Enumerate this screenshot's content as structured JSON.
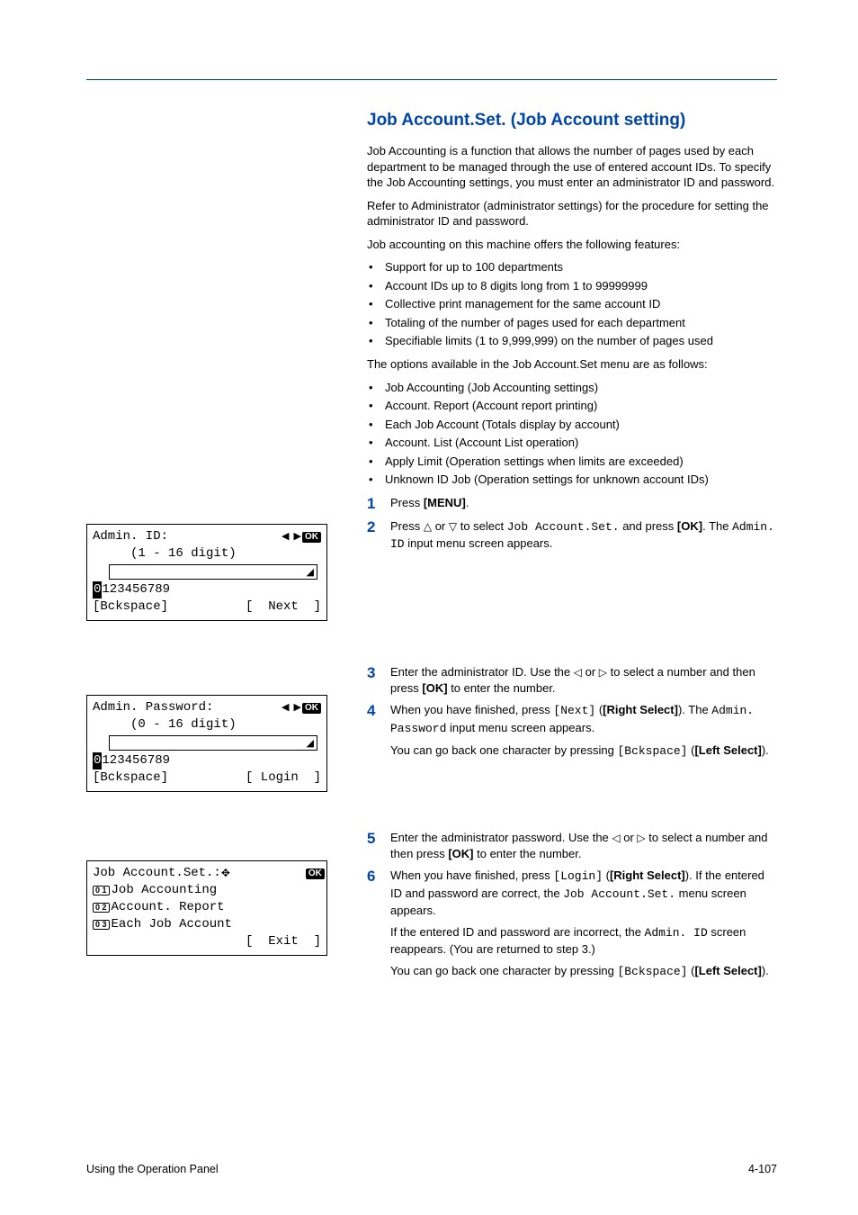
{
  "section_title": "Job Account.Set. (Job Account setting)",
  "intro_p1": "Job Accounting is a function that allows the number of pages used by each department to be managed through the use of entered account IDs. To specify the Job Accounting settings, you must enter an administrator ID and password.",
  "intro_p2": "Refer to Administrator (administrator settings) for the procedure for setting the administrator ID and password.",
  "intro_p3": "Job accounting on this machine offers the following features:",
  "features": [
    "Support for up to 100 departments",
    "Account IDs up to 8 digits long from 1 to 99999999",
    "Collective print management for the same account ID",
    "Totaling of the number of pages used for each department",
    "Specifiable limits (1 to 9,999,999) on the number of pages used"
  ],
  "options_lead": "The options available in the Job Account.Set menu are as follows:",
  "options": [
    "Job Accounting (Job Accounting settings)",
    "Account. Report (Account report printing)",
    "Each Job Account (Totals display by account)",
    "Account. List (Account List operation)",
    "Apply Limit (Operation settings when limits are exceeded)",
    "Unknown ID Job (Operation settings for unknown account IDs)"
  ],
  "steps": {
    "s1_a": "Press ",
    "s1_menu": "[MENU]",
    "s1_b": ".",
    "s2_a": "Press ",
    "s2_b": " or ",
    "s2_c": " to select ",
    "s2_code": "Job Account.Set.",
    "s2_d": " and press ",
    "s2_ok": "[OK]",
    "s2_e": ". The ",
    "s2_code2": "Admin. ID",
    "s2_f": " input menu screen appears.",
    "s3_a": "Enter the administrator ID. Use the ",
    "s3_b": " or ",
    "s3_c": " to select a number and then press ",
    "s3_ok": "[OK]",
    "s3_d": " to enter the number.",
    "s4_a": "When you have finished, press ",
    "s4_code": "[Next]",
    "s4_b": " (",
    "s4_rs": "[Right Select]",
    "s4_c": "). The ",
    "s4_code2": "Admin. Password",
    "s4_d": " input menu screen appears.",
    "s4_sub_a": "You can go back one character by pressing ",
    "s4_sub_code": "[Bckspace]",
    "s4_sub_b": " (",
    "s4_sub_ls": "[Left Select]",
    "s4_sub_c": ").",
    "s5_a": "Enter the administrator password. Use the ",
    "s5_b": " or ",
    "s5_c": " to select a number and then press ",
    "s5_ok": "[OK]",
    "s5_d": " to enter the number.",
    "s6_a": "When you have finished, press ",
    "s6_code": "[Login]",
    "s6_b": " (",
    "s6_rs": "[Right Select]",
    "s6_c": "). If the entered ID and password are correct, the ",
    "s6_code2": "Job Account.Set.",
    "s6_d": " menu screen appears.",
    "s6_sub1_a": "If the entered ID and password are incorrect, the ",
    "s6_sub1_code": "Admin. ID",
    "s6_sub1_b": " screen reappears. (You are returned to step 3.)",
    "s6_sub2_a": "You can go back one character by pressing ",
    "s6_sub2_code": "[Bckspace]",
    "s6_sub2_b": " (",
    "s6_sub2_ls": "[Left Select]",
    "s6_sub2_c": ")."
  },
  "lcd1": {
    "title": "Admin. ID:",
    "range": "(1 - 16 digit)",
    "digits_hl": "0",
    "digits_rest": "123456789",
    "left": "[Bckspace]",
    "right": "[  Next  ]"
  },
  "lcd2": {
    "title": "Admin. Password:",
    "range": "(0 - 16 digit)",
    "digits_hl": "0",
    "digits_rest": "123456789",
    "left": "[Bckspace]",
    "right": "[ Login  ]"
  },
  "lcd3": {
    "title": "Job Account.Set.:",
    "item1": "Job Accounting",
    "item2": "Account. Report",
    "item3": "Each Job Account",
    "exit": "[  Exit  ]"
  },
  "footer_left": "Using the Operation Panel",
  "footer_right": "4-107"
}
